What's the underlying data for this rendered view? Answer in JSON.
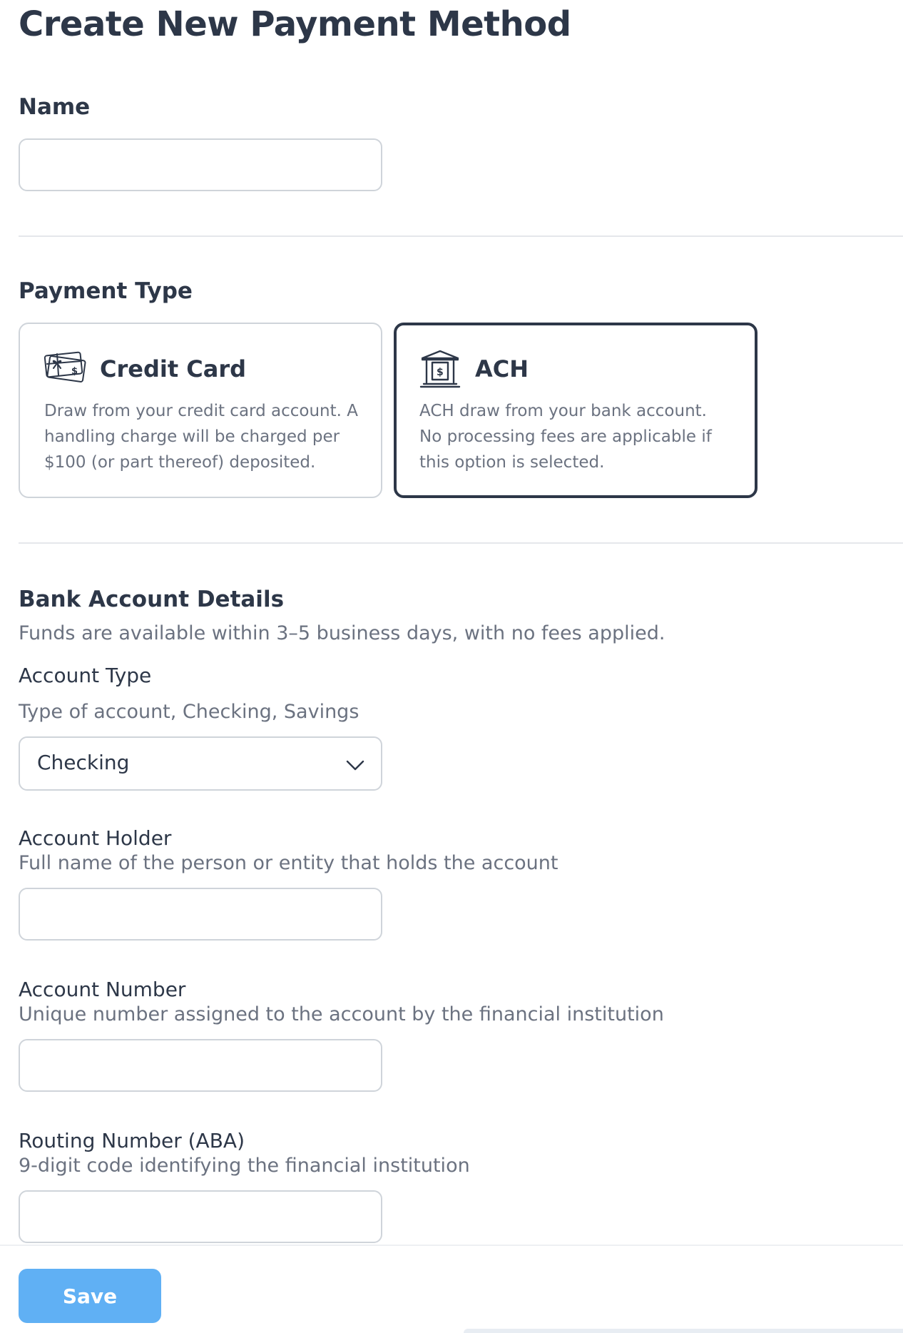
{
  "page": {
    "title": "Create New Payment Method"
  },
  "name_field": {
    "label": "Name",
    "value": "",
    "placeholder": ""
  },
  "payment_type": {
    "label": "Payment Type",
    "options": [
      {
        "title": "Credit Card",
        "description": "Draw from your credit card account. A handling charge will be charged per $100 (or part thereof) deposited.",
        "icon": "credit-card-icon",
        "selected": false
      },
      {
        "title": "ACH",
        "description": "ACH draw from your bank account. No processing fees are applicable if this option is selected.",
        "icon": "bank-icon",
        "selected": true
      }
    ]
  },
  "bank_details": {
    "heading": "Bank Account Details",
    "subtitle": "Funds are available within 3–5 business days, with no fees applied.",
    "account_type": {
      "label": "Account Type",
      "helper": "Type of account, Checking, Savings",
      "selected": "Checking",
      "icon": "chevron-down-icon"
    },
    "account_holder": {
      "label": "Account Holder",
      "helper": "Full name of the person or entity that holds the account",
      "value": ""
    },
    "account_number": {
      "label": "Account Number",
      "helper": "Unique number assigned to the account by the financial institution",
      "value": ""
    },
    "routing_number": {
      "label": "Routing Number (ABA)",
      "helper": "9-digit code identifying the financial institution",
      "value": ""
    }
  },
  "footer": {
    "save_label": "Save"
  },
  "colors": {
    "text_primary": "#2d3748",
    "text_secondary": "#6b7280",
    "border": "#cfd4da",
    "selected_border": "#2d3748",
    "save_button": "#60b0f4"
  }
}
